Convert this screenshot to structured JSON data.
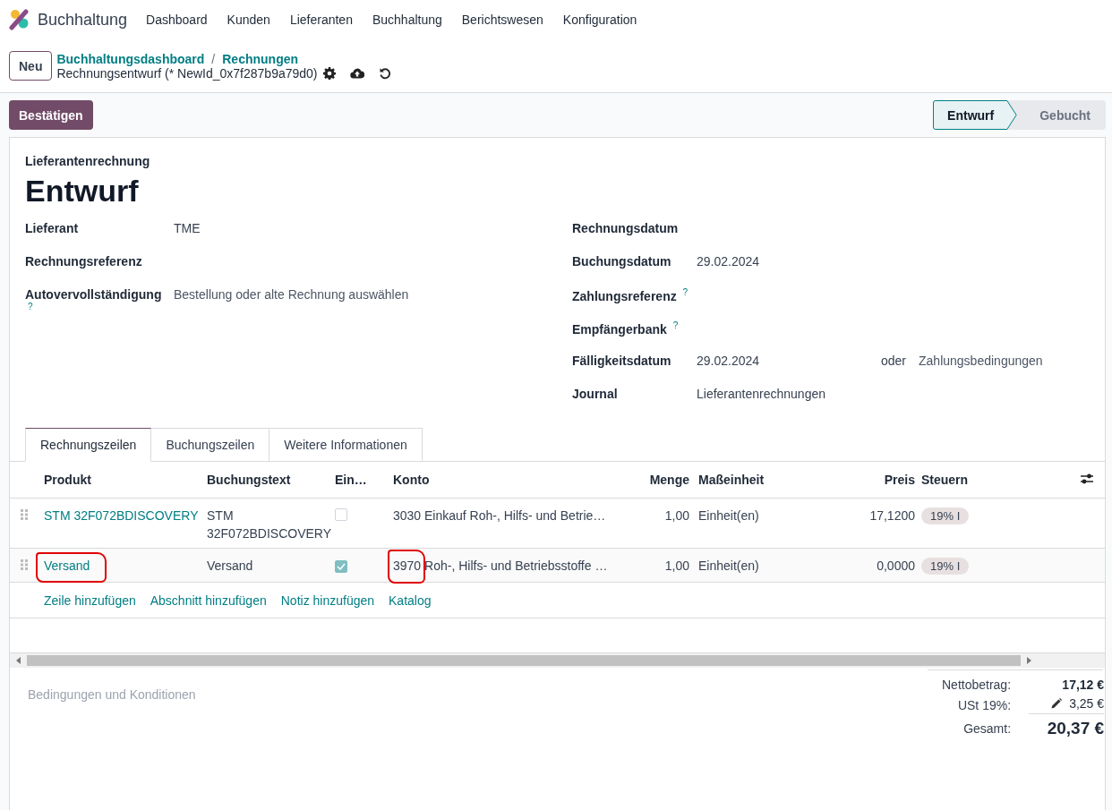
{
  "app": {
    "name": "Buchhaltung"
  },
  "menu": [
    "Dashboard",
    "Kunden",
    "Lieferanten",
    "Buchhaltung",
    "Berichtswesen",
    "Konfiguration"
  ],
  "control_panel": {
    "new_button": "Neu",
    "breadcrumbs": [
      "Buchhaltungsdashboard",
      "Rechnungen"
    ],
    "separator": "/",
    "record": "Rechnungsentwurf (* NewId_0x7f287b9a79d0)"
  },
  "confirm_button": "Bestätigen",
  "status_steps": [
    {
      "label": "Entwurf",
      "selected": true
    },
    {
      "label": "Gebucht",
      "selected": false
    }
  ],
  "sheet": {
    "type": "Lieferantenrechnung",
    "title": "Entwurf"
  },
  "left_fields": [
    {
      "label": "Lieferant",
      "value": "TME"
    },
    {
      "label": "Rechnungsreferenz"
    },
    {
      "label": "Autovervollständigung",
      "help": "?",
      "placeholder": "Bestellung oder alte Rechnung auswählen"
    }
  ],
  "right_fields": [
    {
      "label": "Rechnungsdatum"
    },
    {
      "label": "Buchungsdatum",
      "value": "29.02.2024"
    },
    {
      "label": "Zahlungsreferenz",
      "help": "?"
    },
    {
      "label": "Empfängerbank",
      "help": "?"
    },
    {
      "label": "Fälligkeitsdatum",
      "value": "29.02.2024",
      "connector": "oder",
      "placeholder": "Zahlungsbedingungen"
    },
    {
      "label": "Journal",
      "value": "Lieferantenrechnungen"
    }
  ],
  "tabs": [
    {
      "label": "Rechnungszeilen",
      "selected": true
    },
    {
      "label": "Buchungszeilen",
      "selected": false
    },
    {
      "label": "Weitere Informationen",
      "selected": false
    }
  ],
  "table": {
    "columns": [
      "Produkt",
      "Buchungstext",
      "Ein…",
      "Konto",
      "Menge",
      "Maßeinheit",
      "Preis",
      "Steuern"
    ],
    "rows": [
      {
        "product": "STM 32F072BDISCOVERY",
        "label": "STM 32F072BDISCOVERY",
        "checked": false,
        "account": "3030 Einkauf Roh-, Hilfs- und Betrie…",
        "quantity": "1,00",
        "uom": "Einheit(en)",
        "price": "17,1200",
        "tax": "19% I",
        "product_marked": false,
        "account_number_marked": false
      },
      {
        "product": "Versand",
        "label": "Versand",
        "checked": true,
        "account": "3970 Roh-, Hilfs- und Betriebsstoffe …",
        "quantity": "1,00",
        "uom": "Einheit(en)",
        "price": "0,0000",
        "tax": "19% I",
        "product_marked": true,
        "account_number_marked": true
      }
    ],
    "add_links": [
      "Zeile hinzufügen",
      "Abschnitt hinzufügen",
      "Notiz hinzufügen",
      "Katalog"
    ]
  },
  "terms_placeholder": "Bedingungen und Konditionen",
  "totals": {
    "untaxed_label": "Nettobetrag:",
    "untaxed": "17,12 €",
    "tax_label": "USt 19%:",
    "tax": "3,25 €",
    "total_label": "Gesamt:",
    "total": "20,37 €"
  }
}
